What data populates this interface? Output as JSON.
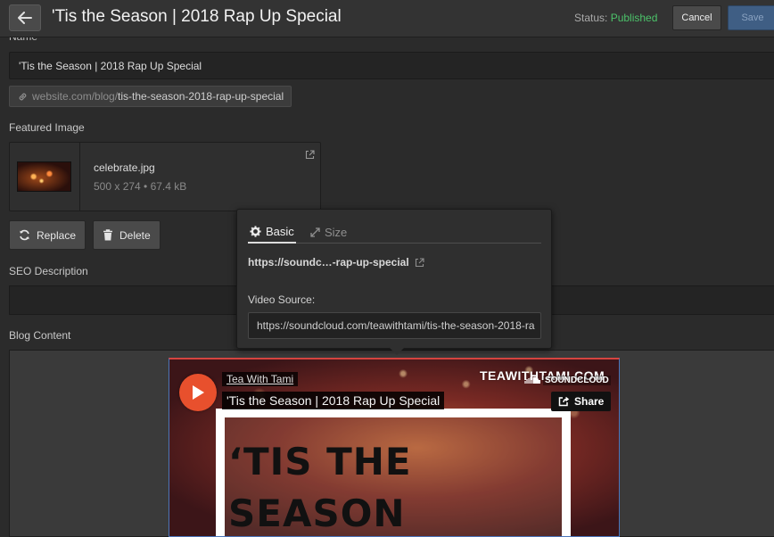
{
  "header": {
    "title": "'Tis the Season | 2018 Rap Up Special",
    "status_label": "Status:",
    "status_value": "Published",
    "cancel_label": "Cancel",
    "save_label": "Save"
  },
  "form": {
    "name_label": "Name",
    "name_value": "'Tis the Season | 2018 Rap Up Special",
    "slug_prefix": "website.com/blog/",
    "slug_value": "tis-the-season-2018-rap-up-special",
    "featured_image_label": "Featured Image",
    "image": {
      "file_name": "celebrate.jpg",
      "meta": "500 x 274 • 67.4 kB"
    },
    "replace_label": "Replace",
    "delete_label": "Delete",
    "seo_label": "SEO Description",
    "blog_content_label": "Blog Content"
  },
  "embed": {
    "user": "Tea With Tami",
    "track": "'Tis the Season | 2018 Rap Up Special",
    "brand": "TEAWITHTAMI.COM",
    "provider": "SOUNDCLOUD",
    "share_label": "Share",
    "art_line_1": "‘TIS THE",
    "art_line_2": "SEASON"
  },
  "popover": {
    "tab_basic": "Basic",
    "tab_size": "Size",
    "url_short": "https://soundc…-rap-up-special",
    "video_source_label": "Video Source:",
    "video_source_value": "https://soundcloud.com/teawithtami/tis-the-season-2018-ra"
  },
  "colors": {
    "published": "#4cc36a",
    "save_button": "#3f5e84",
    "selection_border": "#4b76bb",
    "embed_top_border": "#d64440",
    "play_button": "#e8502d"
  }
}
